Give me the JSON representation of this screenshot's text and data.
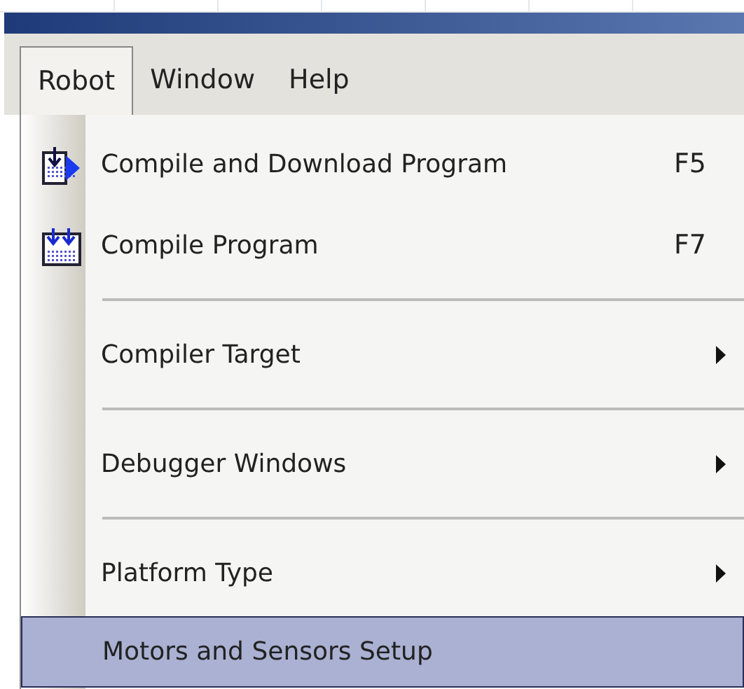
{
  "menu_bar": [
    {
      "label": "Robot",
      "selected": true
    },
    {
      "label": "Window",
      "selected": false
    },
    {
      "label": "Help",
      "selected": false
    }
  ],
  "menu": {
    "items": [
      {
        "kind": "download",
        "label": "Compile and Download Program",
        "shortcut": "F5",
        "selected": false
      },
      {
        "kind": "compile",
        "label": "Compile Program",
        "shortcut": "F7",
        "selected": false
      },
      {
        "kind": "separator"
      },
      {
        "kind": "submenu",
        "label": "Compiler Target",
        "selected": false
      },
      {
        "kind": "separator"
      },
      {
        "kind": "submenu",
        "label": "Debugger Windows",
        "selected": false
      },
      {
        "kind": "separator"
      },
      {
        "kind": "submenu",
        "label": "Platform Type",
        "selected": false
      },
      {
        "kind": "command",
        "label": "Motors and Sensors Setup",
        "selected": true
      }
    ]
  }
}
